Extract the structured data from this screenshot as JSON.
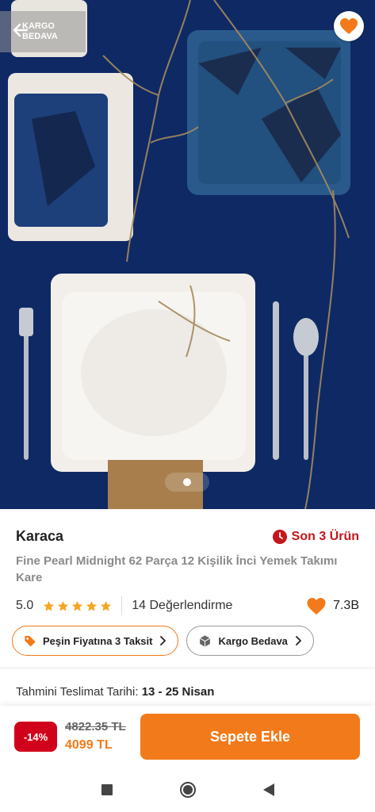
{
  "hero": {
    "cargo_badge_line1": "KARGO",
    "cargo_badge_line2": "BEDAVA",
    "image_count": 1,
    "active_image": 1
  },
  "product": {
    "brand": "Karaca",
    "stock_text": "Son 3 Ürün",
    "title": "Fine Pearl Midnight 62 Parça 12 Kişilik İnci Yemek Takımı Kare",
    "rating_score": "5.0",
    "rating_stars": 5,
    "reviews_text": "14 Değerlendirme",
    "favorites_count": "7.3B"
  },
  "chips": {
    "installment": "Peşin Fiyatına 3 Taksit",
    "free_shipping": "Kargo Bedava"
  },
  "delivery": {
    "label": "Tahmini Teslimat Tarihi:",
    "dates": "13 - 25 Nisan"
  },
  "price": {
    "discount": "-14%",
    "old_price": "4822.35 TL",
    "new_price": "4099 TL",
    "cart_button": "Sepete Ekle"
  },
  "colors": {
    "accent": "#f27a1a",
    "stock_red": "#c4161c",
    "discount_red": "#d0021b",
    "star": "#f5a623",
    "hero_bg": "#0f2a66"
  },
  "icons": {
    "back": "arrow-left-icon",
    "favorite": "heart-icon",
    "stock": "clock-icon",
    "star": "star-icon",
    "likes": "heart-icon",
    "installment": "tag-icon",
    "shipping": "box-icon",
    "chevron": "chevron-right-icon",
    "nav_recents": "square-icon",
    "nav_home": "circle-icon",
    "nav_back": "triangle-back-icon"
  }
}
